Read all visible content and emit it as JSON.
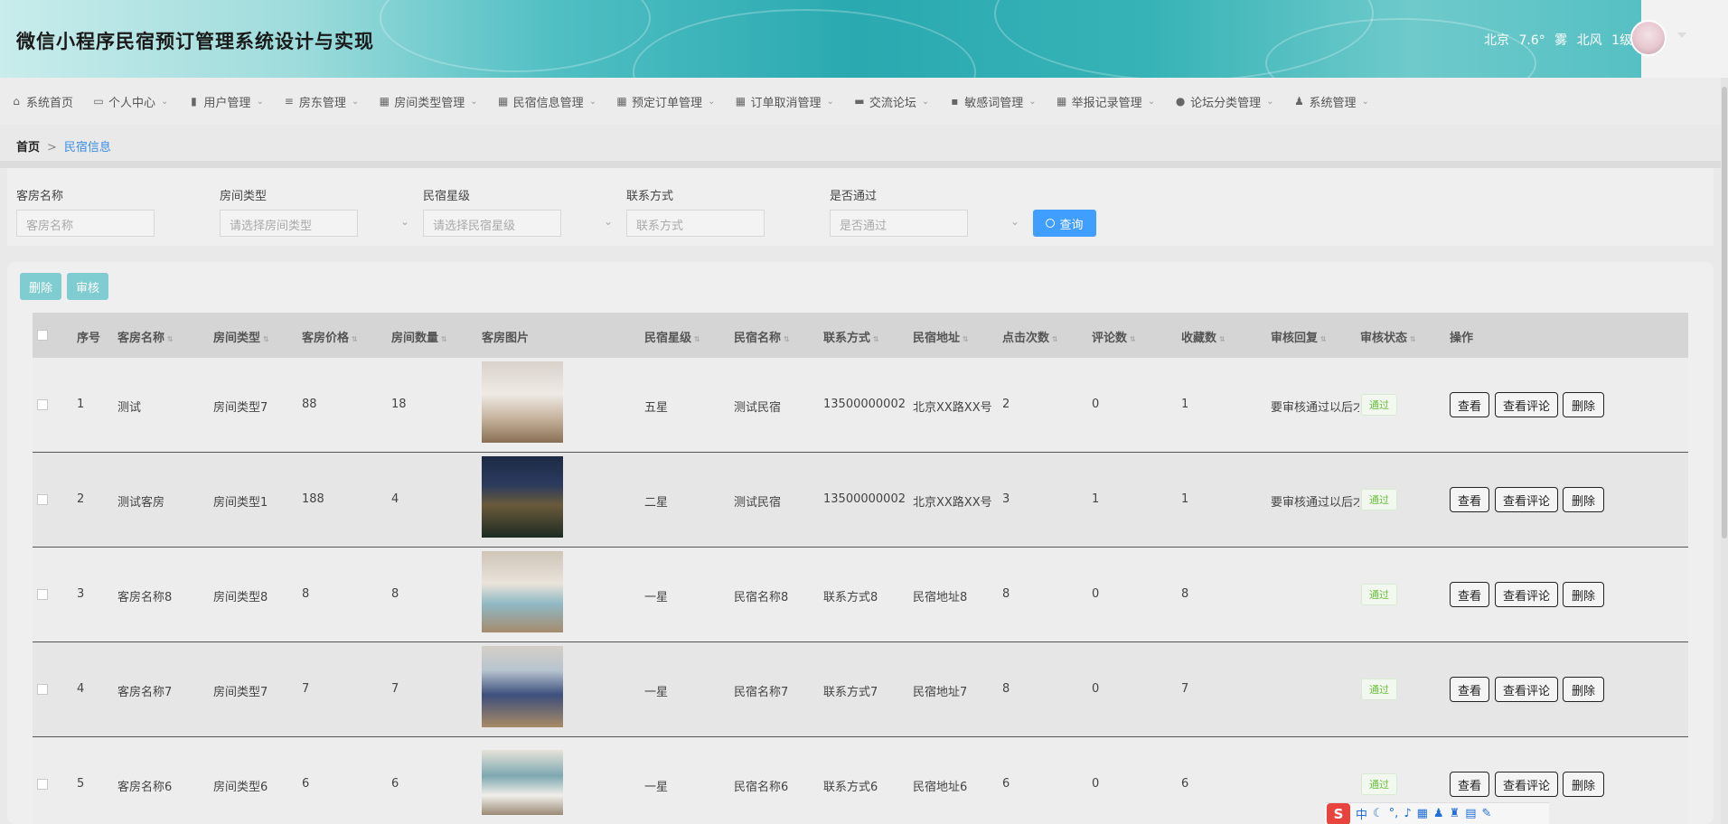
{
  "app": {
    "title": "微信小程序民宿预订管理系统设计与实现"
  },
  "weather": {
    "city": "北京",
    "temp": "7.6°",
    "condition": "雾",
    "wind": "北风",
    "level": "1级"
  },
  "nav": [
    {
      "label": "系统首页",
      "icon": "home-icon"
    },
    {
      "label": "个人中心",
      "icon": "card-icon"
    },
    {
      "label": "用户管理",
      "icon": "clipboard-icon"
    },
    {
      "label": "房东管理",
      "icon": "list-icon"
    },
    {
      "label": "房间类型管理",
      "icon": "grid-icon"
    },
    {
      "label": "民宿信息管理",
      "icon": "grid-icon"
    },
    {
      "label": "预定订单管理",
      "icon": "grid-icon"
    },
    {
      "label": "订单取消管理",
      "icon": "grid-icon"
    },
    {
      "label": "交流论坛",
      "icon": "printer-icon"
    },
    {
      "label": "敏感词管理",
      "icon": "chat-icon"
    },
    {
      "label": "举报记录管理",
      "icon": "grid-icon"
    },
    {
      "label": "论坛分类管理",
      "icon": "location-icon"
    },
    {
      "label": "系统管理",
      "icon": "user-icon"
    }
  ],
  "breadcrumb": {
    "home": "首页",
    "sep": ">",
    "current": "民宿信息"
  },
  "search": {
    "room_name": {
      "label": "客房名称",
      "placeholder": "客房名称"
    },
    "room_type": {
      "label": "房间类型",
      "placeholder": "请选择房间类型"
    },
    "star": {
      "label": "民宿星级",
      "placeholder": "请选择民宿星级"
    },
    "contact": {
      "label": "联系方式",
      "placeholder": "联系方式"
    },
    "approved": {
      "label": "是否通过",
      "placeholder": "是否通过"
    },
    "query_label": "查询"
  },
  "actions": {
    "delete_label": "删除",
    "review_label": "审核"
  },
  "table": {
    "columns": [
      "序号",
      "客房名称",
      "房间类型",
      "客房价格",
      "房间数量",
      "客房图片",
      "民宿星级",
      "民宿名称",
      "联系方式",
      "民宿地址",
      "点击次数",
      "评论数",
      "收藏数",
      "审核回复",
      "审核状态",
      "操作"
    ],
    "rows": [
      {
        "no": "1",
        "name": "测试",
        "type": "房间类型7",
        "price": "88",
        "qty": "18",
        "star": "五星",
        "homestay": "测试民宿",
        "contact": "13500000002",
        "address": "北京XX路XX号",
        "clicks": "2",
        "comments": "0",
        "favs": "1",
        "reply": "要审核通过以后才",
        "status": "通过"
      },
      {
        "no": "2",
        "name": "测试客房",
        "type": "房间类型1",
        "price": "188",
        "qty": "4",
        "star": "二星",
        "homestay": "测试民宿",
        "contact": "13500000002",
        "address": "北京XX路XX号",
        "clicks": "3",
        "comments": "1",
        "favs": "1",
        "reply": "要审核通过以后才",
        "status": "通过"
      },
      {
        "no": "3",
        "name": "客房名称8",
        "type": "房间类型8",
        "price": "8",
        "qty": "8",
        "star": "一星",
        "homestay": "民宿名称8",
        "contact": "联系方式8",
        "address": "民宿地址8",
        "clicks": "8",
        "comments": "0",
        "favs": "8",
        "reply": "",
        "status": "通过"
      },
      {
        "no": "4",
        "name": "客房名称7",
        "type": "房间类型7",
        "price": "7",
        "qty": "7",
        "star": "一星",
        "homestay": "民宿名称7",
        "contact": "联系方式7",
        "address": "民宿地址7",
        "clicks": "8",
        "comments": "0",
        "favs": "7",
        "reply": "",
        "status": "通过"
      },
      {
        "no": "5",
        "name": "客房名称6",
        "type": "房间类型6",
        "price": "6",
        "qty": "6",
        "star": "一星",
        "homestay": "民宿名称6",
        "contact": "联系方式6",
        "address": "民宿地址6",
        "clicks": "6",
        "comments": "0",
        "favs": "6",
        "reply": "",
        "status": "通过"
      }
    ],
    "ops": {
      "view": "查看",
      "view_comments": "查看评论",
      "delete": "删除"
    }
  },
  "ime": {
    "logo": "S",
    "mode": "中"
  },
  "colors": {
    "accent": "#409eff",
    "teal_button": "#7fcdd1",
    "pass_green": "#67c23a"
  }
}
